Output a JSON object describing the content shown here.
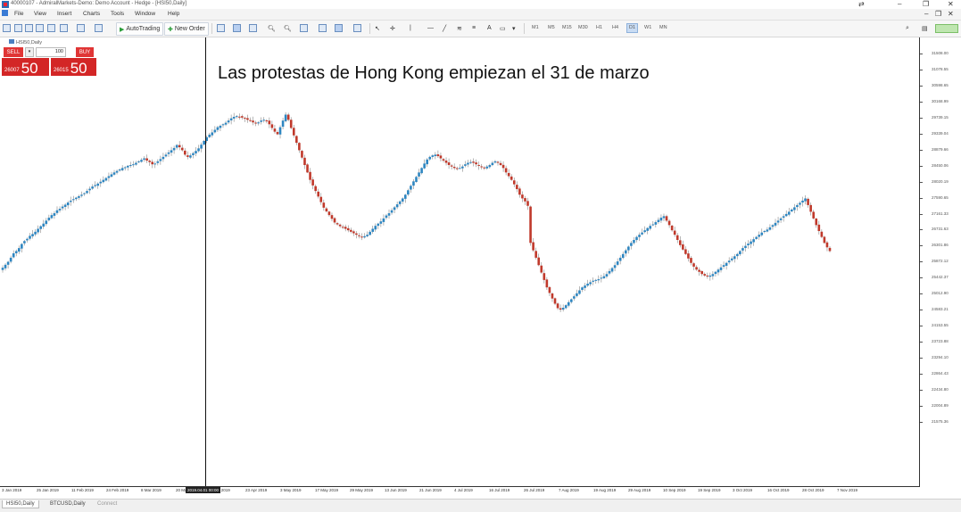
{
  "window": {
    "title": "40000107 - AdmiralMarkets-Demo: Demo Account - Hedge - [HSI50,Daily]"
  },
  "menu": [
    "File",
    "View",
    "Insert",
    "Charts",
    "Tools",
    "Window",
    "Help"
  ],
  "toolbar": {
    "autotrading_label": "AutoTrading",
    "new_order_label": "New Order",
    "timeframes": [
      "M1",
      "M5",
      "M15",
      "M30",
      "H1",
      "H4",
      "D1",
      "W1",
      "MN"
    ],
    "active_timeframe": "D1"
  },
  "chart": {
    "symbol_label": "HSI50,Daily",
    "annotation": "Las protestas de Hong Kong empiezan el 31 de marzo",
    "cursor_date": "2019.04.01 00:00",
    "colors": {
      "bull": "#2e86c1",
      "bear": "#c0392b"
    }
  },
  "trade_panel": {
    "sell_label": "SELL",
    "buy_label": "BUY",
    "volume": "100",
    "sell_price_small": "26007",
    "sell_price_big": "50",
    "buy_price_small": "26015",
    "buy_price_big": "50"
  },
  "chart_data": {
    "type": "candlestick",
    "title": "",
    "y_axis_labels": [
      "31508.00",
      "31078.55",
      "30598.65",
      "30168.99",
      "29739.15",
      "29339.04",
      "28879.66",
      "28450.06",
      "28020.19",
      "27590.65",
      "27161.33",
      "26731.63",
      "26301.86",
      "25872.12",
      "25442.37",
      "25012.90",
      "24583.21",
      "24153.55",
      "23723.88",
      "23294.10",
      "22864.43",
      "22434.80",
      "22004.89",
      "21575.36"
    ],
    "x_axis_labels": [
      "3 Jan 2019",
      "25 Jan 2019",
      "11 Feb 2019",
      "24 Feb 2019",
      "8 Mar 2019",
      "20 Mar 2019",
      "9 Apr 2019",
      "23 Apr 2019",
      "3 May 2019",
      "17 May 2019",
      "29 May 2019",
      "13 Jun 2019",
      "21 Jun 2019",
      "4 Jul 2019",
      "16 Jul 2019",
      "26 Jul 2019",
      "7 Aug 2019",
      "19 Aug 2019",
      "29 Aug 2019",
      "10 Sep 2019",
      "19 Sep 2019",
      "3 Oct 2019",
      "16 Oct 2019",
      "28 Oct 2019",
      "7 Nov 2019"
    ],
    "close_series": [
      25730,
      25810,
      25890,
      26000,
      26120,
      26180,
      26260,
      26370,
      26450,
      26510,
      26590,
      26640,
      26700,
      26780,
      26850,
      26920,
      27000,
      27080,
      27150,
      27200,
      27280,
      27320,
      27380,
      27430,
      27490,
      27540,
      27580,
      27620,
      27660,
      27700,
      27740,
      27800,
      27860,
      27920,
      27960,
      28000,
      28050,
      28100,
      28150,
      28200,
      28250,
      28300,
      28340,
      28380,
      28420,
      28440,
      28480,
      28500,
      28520,
      28560,
      28600,
      28640,
      28680,
      28620,
      28580,
      28520,
      28540,
      28600,
      28660,
      28720,
      28780,
      28840,
      28900,
      28960,
      29040,
      28980,
      28900,
      28780,
      28720,
      28760,
      28820,
      28880,
      28950,
      29050,
      29150,
      29250,
      29320,
      29380,
      29450,
      29520,
      29560,
      29600,
      29640,
      29700,
      29760,
      29800,
      29820,
      29800,
      29780,
      29760,
      29720,
      29690,
      29650,
      29620,
      29650,
      29700,
      29720,
      29680,
      29600,
      29500,
      29400,
      29330,
      29520,
      29700,
      29860,
      29720,
      29500,
      29300,
      29100,
      28900,
      28700,
      28500,
      28300,
      28100,
      27950,
      27800,
      27650,
      27500,
      27350,
      27250,
      27150,
      27050,
      26950,
      26900,
      26850,
      26820,
      26780,
      26740,
      26700,
      26660,
      26620,
      26580,
      26560,
      26580,
      26620,
      26700,
      26780,
      26860,
      26920,
      26980,
      27060,
      27140,
      27200,
      27280,
      27360,
      27440,
      27520,
      27600,
      27700,
      27820,
      27940,
      28060,
      28180,
      28300,
      28420,
      28540,
      28650,
      28720,
      28760,
      28780,
      28740,
      28680,
      28620,
      28560,
      28500,
      28460,
      28420,
      28400,
      28420,
      28460,
      28520,
      28560,
      28580,
      28560,
      28520,
      28480,
      28440,
      28420,
      28460,
      28500,
      28560,
      28600,
      28560,
      28500,
      28420,
      28300,
      28200,
      28100,
      27980,
      27850,
      27700,
      27600,
      27520,
      27400,
      26400,
      26200,
      26000,
      25800,
      25600,
      25400,
      25200,
      25050,
      24900,
      24760,
      24640,
      24600,
      24650,
      24720,
      24800,
      24880,
      24960,
      25040,
      25120,
      25200,
      25250,
      25300,
      25340,
      25380,
      25400,
      25420,
      25460,
      25500,
      25560,
      25640,
      25720,
      25800,
      25900,
      26000,
      26100,
      26200,
      26300,
      26400,
      26480,
      26560,
      26620,
      26680,
      26740,
      26800,
      26860,
      26900,
      26960,
      27020,
      27080,
      27120,
      27000,
      26880,
      26740,
      26620,
      26480,
      26340,
      26220,
      26100,
      25980,
      25860,
      25760,
      25680,
      25620,
      25560,
      25520,
      25500,
      25520,
      25560,
      25620,
      25680,
      25740,
      25800,
      25860,
      25920,
      25980,
      26040,
      26100,
      26180,
      26260,
      26320,
      26380,
      26440,
      26500,
      26560,
      26620,
      26680,
      26720,
      26760,
      26820,
      26880,
      26940,
      27000,
      27060,
      27120,
      27180,
      27240,
      27300,
      27360,
      27420,
      27480,
      27540,
      27600,
      27420,
      27240,
      27060,
      26880,
      26720,
      26560,
      26400,
      26280,
      26180
    ]
  },
  "tabs": [
    {
      "label": "HSI50,Daily",
      "active": true
    },
    {
      "label": "BTCUSD,Daily",
      "active": false
    },
    {
      "label": "Connect",
      "active": false,
      "disabled": true
    }
  ]
}
